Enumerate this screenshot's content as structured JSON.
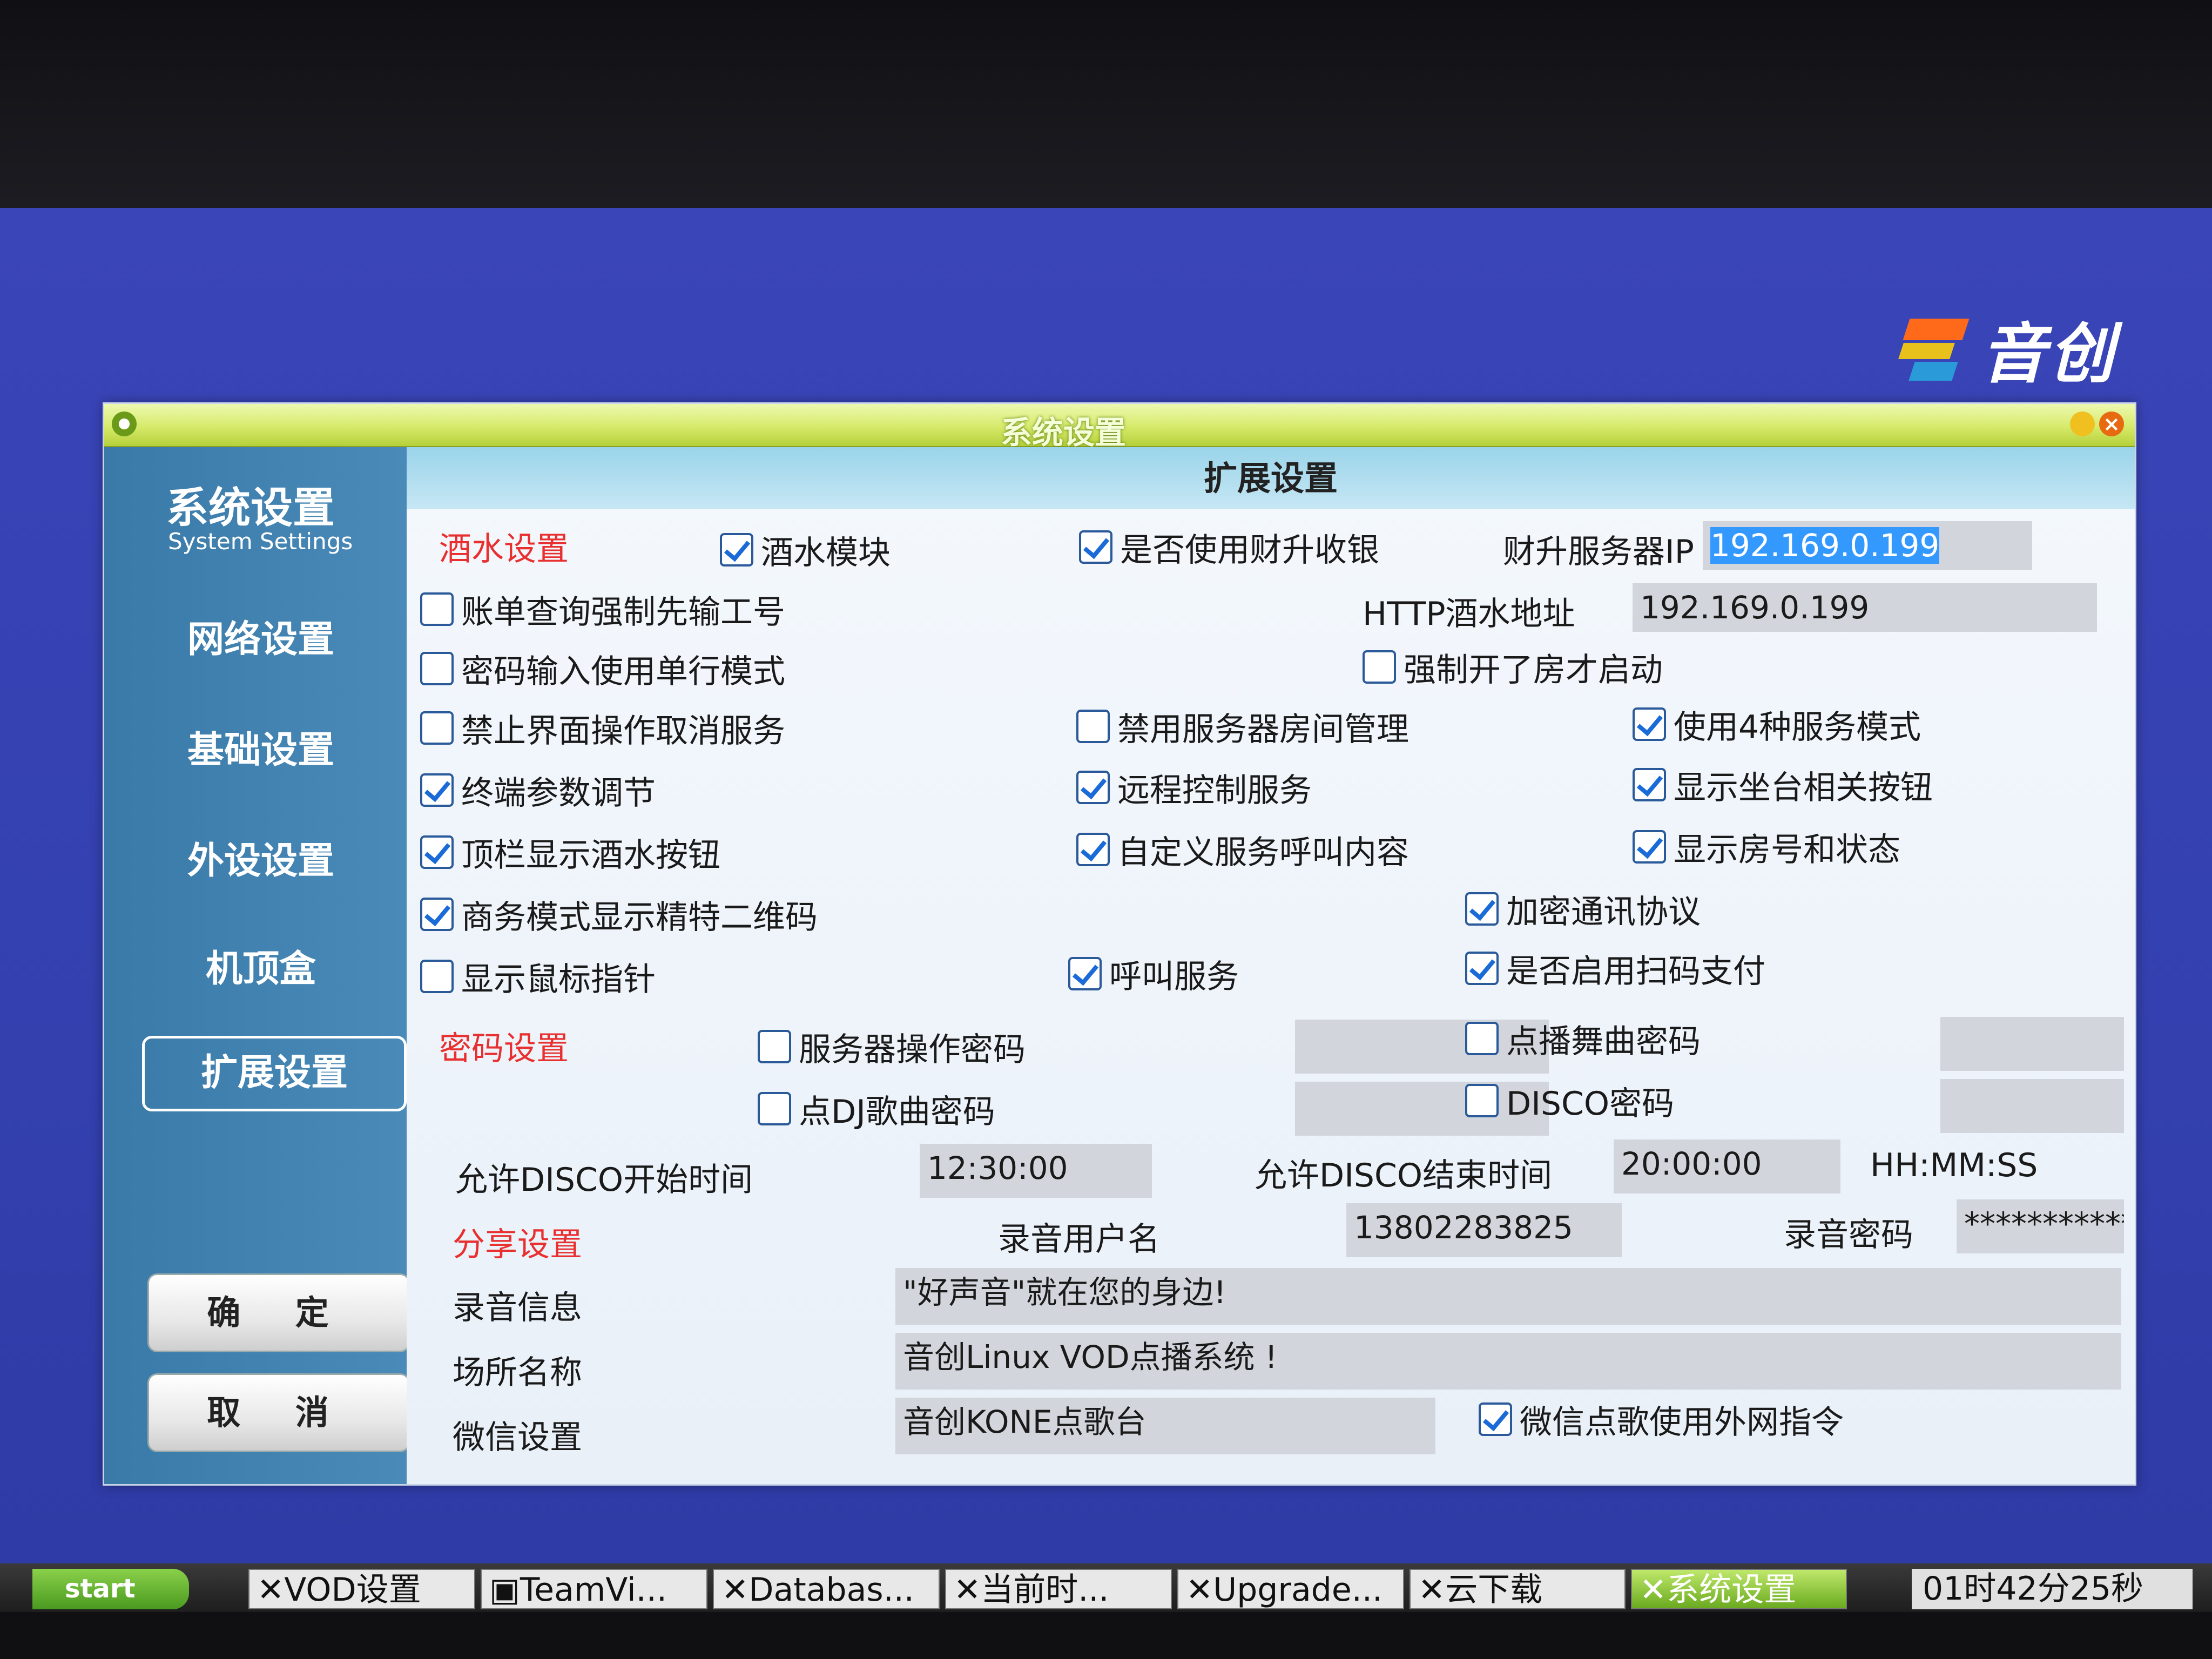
{
  "brand": {
    "name": "音创"
  },
  "window": {
    "title": "系统设置"
  },
  "sidebar": {
    "title": "系统设置",
    "subtitle": "System Settings",
    "items": [
      "网络设置",
      "基础设置",
      "外设设置",
      "机顶盒",
      "扩展设置"
    ],
    "confirm": "确 定",
    "cancel": "取 消"
  },
  "header": "扩展设置",
  "sections": {
    "drinks": "酒水设置",
    "password": "密码设置",
    "share": "分享设置"
  },
  "checkboxes": {
    "drinks_module": {
      "label": "酒水模块",
      "checked": true
    },
    "use_caisheng": {
      "label": "是否使用财升收银",
      "checked": true
    },
    "bill_query": {
      "label": "账单查询强制先输工号",
      "checked": false
    },
    "pwd_single_line": {
      "label": "密码输入使用单行模式",
      "checked": false
    },
    "force_open_room": {
      "label": "强制开了房才启动",
      "checked": false
    },
    "forbid_cancel": {
      "label": "禁止界面操作取消服务",
      "checked": false
    },
    "disable_room_mgmt": {
      "label": "禁用服务器房间管理",
      "checked": false
    },
    "four_modes": {
      "label": "使用4种服务模式",
      "checked": true
    },
    "terminal_params": {
      "label": "终端参数调节",
      "checked": true
    },
    "remote_control": {
      "label": "远程控制服务",
      "checked": true
    },
    "show_desk_buttons": {
      "label": "显示坐台相关按钮",
      "checked": true
    },
    "topbar_drinks": {
      "label": "顶栏显示酒水按钮",
      "checked": true
    },
    "custom_call": {
      "label": "自定义服务呼叫内容",
      "checked": true
    },
    "show_room_status": {
      "label": "显示房号和状态",
      "checked": true
    },
    "biz_qrcode": {
      "label": "商务模式显示精特二维码",
      "checked": true
    },
    "encrypt_protocol": {
      "label": "加密通讯协议",
      "checked": true
    },
    "show_cursor": {
      "label": "显示鼠标指针",
      "checked": false
    },
    "call_service": {
      "label": "呼叫服务",
      "checked": true
    },
    "scan_pay": {
      "label": "是否启用扫码支付",
      "checked": true
    },
    "server_pwd": {
      "label": "服务器操作密码",
      "checked": false
    },
    "dance_pwd": {
      "label": "点播舞曲密码",
      "checked": false
    },
    "dj_pwd": {
      "label": "点DJ歌曲密码",
      "checked": false
    },
    "disco_pwd": {
      "label": "DISCO密码",
      "checked": false
    },
    "wechat_external": {
      "label": "微信点歌使用外网指令",
      "checked": true
    }
  },
  "fields": {
    "caisheng_ip_label": "财升服务器IP",
    "caisheng_ip": "192.169.0.199",
    "http_label": "HTTP酒水地址",
    "http_addr": "192.169.0.199",
    "disco_start_label": "允许DISCO开始时间",
    "disco_start": "12:30:00",
    "disco_end_label": "允许DISCO结束时间",
    "disco_end": "20:00:00",
    "time_format": "HH:MM:SS",
    "rec_user_label": "录音用户名",
    "rec_user": "13802283825",
    "rec_pwd_label": "录音密码",
    "rec_pwd": "***********",
    "rec_info_label": "录音信息",
    "rec_info": "\"好声音\"就在您的身边!",
    "venue_label": "场所名称",
    "venue": "音创Linux VOD点播系统 !",
    "wechat_label": "微信设置",
    "wechat": "音创KONE点歌台"
  },
  "taskbar": {
    "start": "start",
    "items": [
      "VOD设置",
      "TeamVi...",
      "Databas...",
      "当前时...",
      "Upgrade...",
      "云下载",
      "系统设置"
    ],
    "clock": "01时42分25秒"
  }
}
